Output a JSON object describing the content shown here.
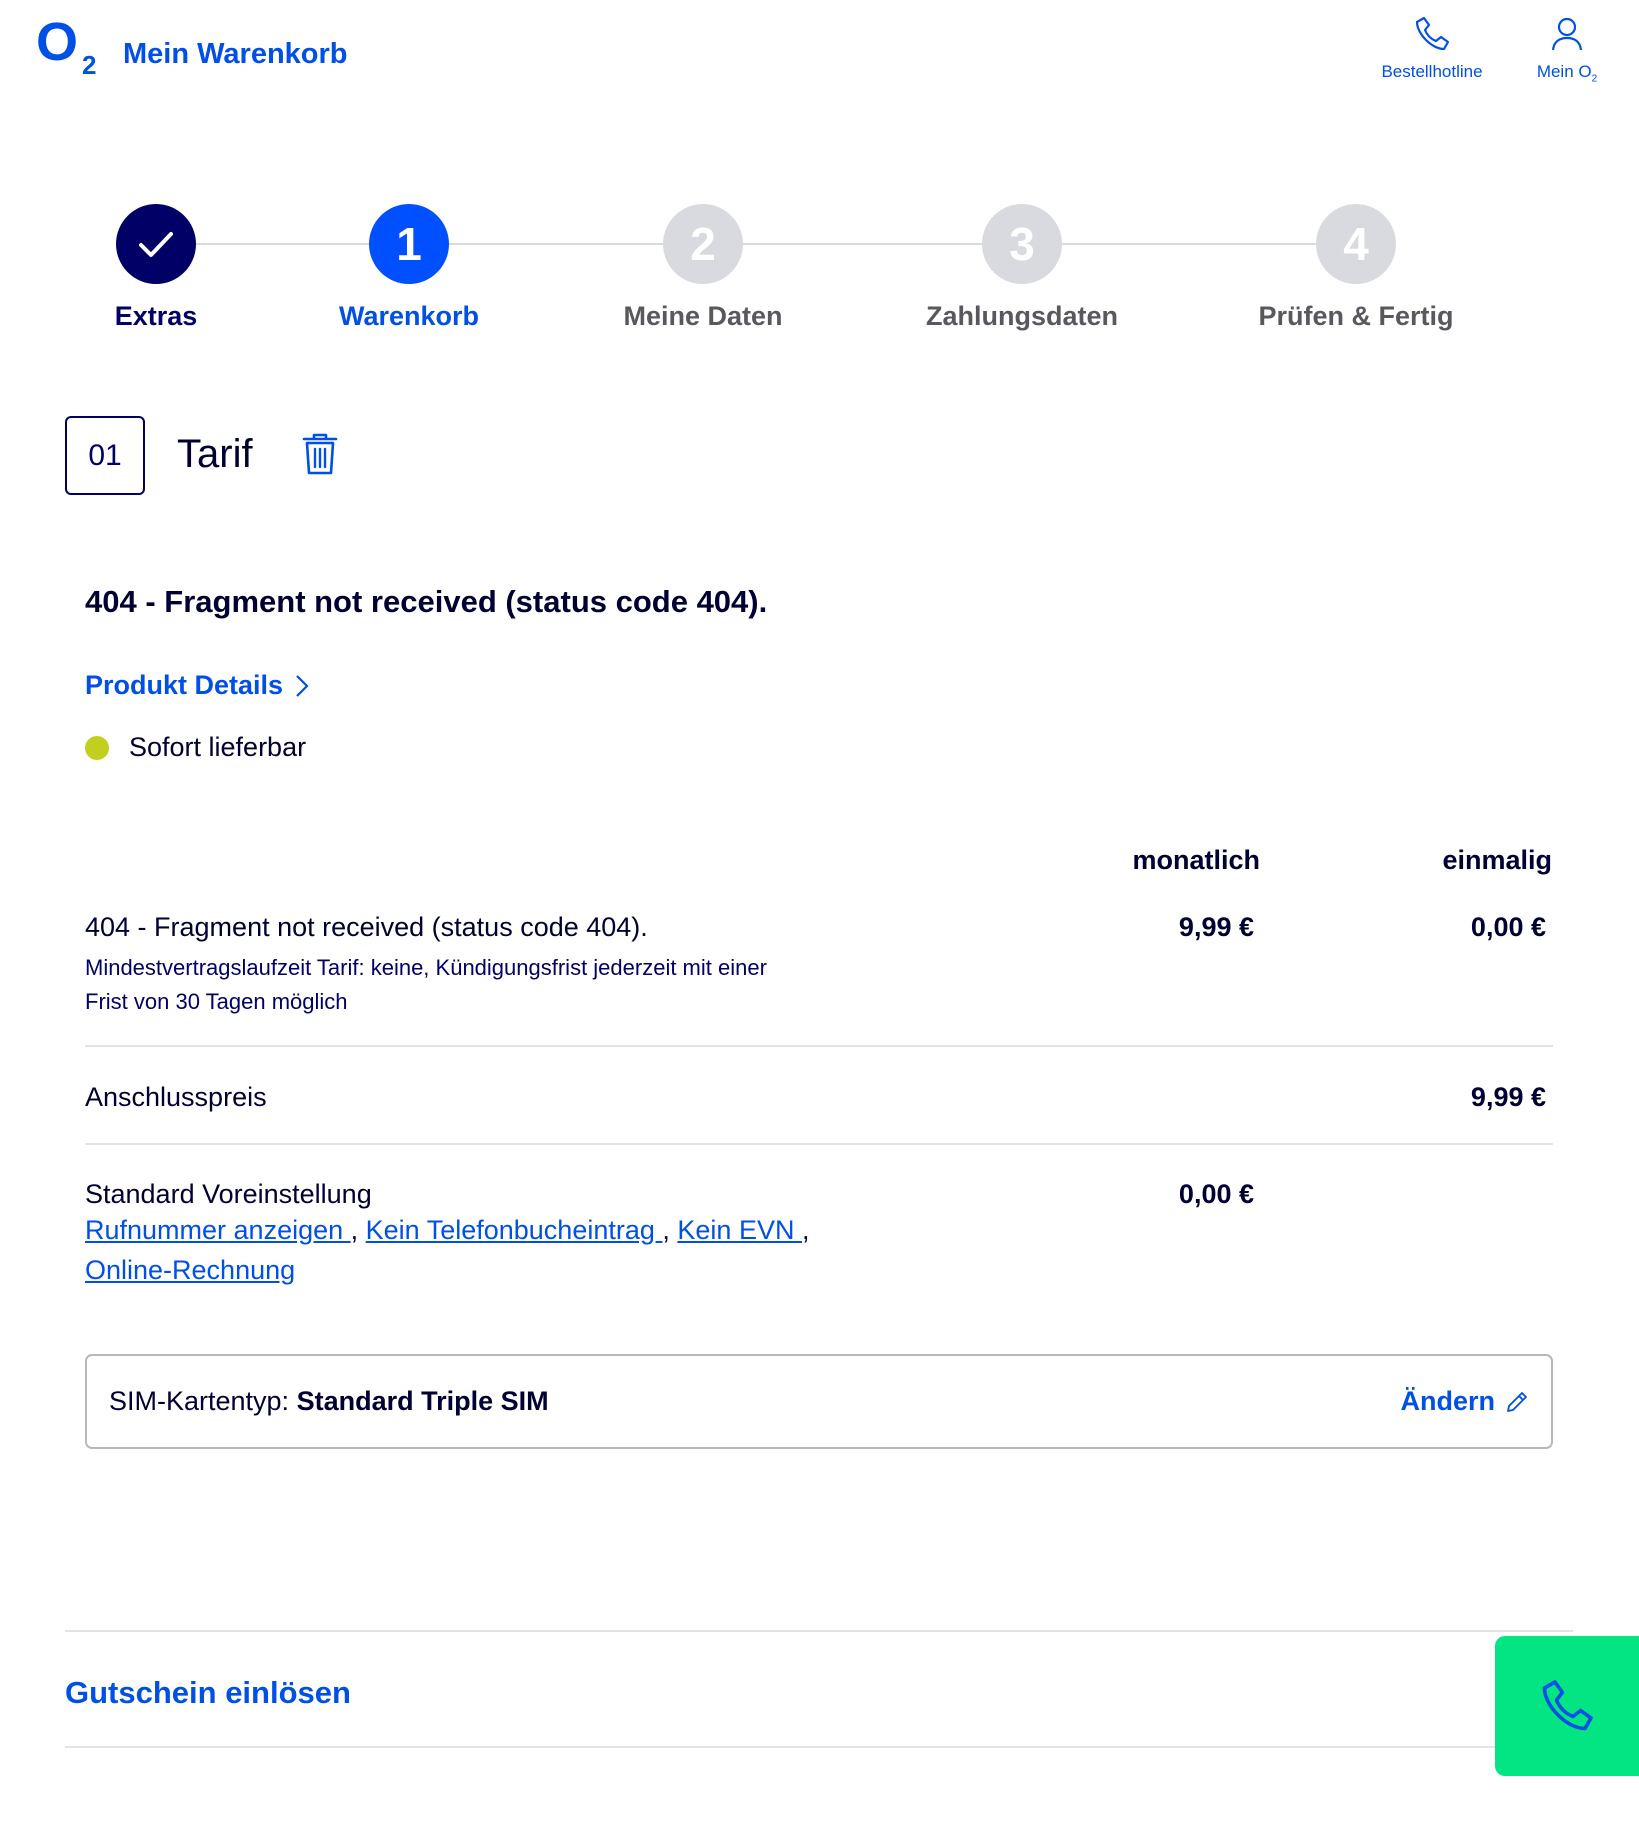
{
  "brand": {
    "logo_letter": "O",
    "logo_sub": "2",
    "accent": "#0050e6",
    "dark": "#000066",
    "success_green": "#03e583",
    "availability_dot": "#c1d01f"
  },
  "header": {
    "title": "Mein Warenkorb",
    "hotline_label": "Bestellhotline",
    "account_label": "Mein O",
    "account_sub": "2"
  },
  "stepper": {
    "steps": [
      {
        "marker": "",
        "label": "Extras",
        "state": "done"
      },
      {
        "marker": "1",
        "label": "Warenkorb",
        "state": "active"
      },
      {
        "marker": "2",
        "label": "Meine Daten",
        "state": "pending"
      },
      {
        "marker": "3",
        "label": "Zahlungsdaten",
        "state": "pending"
      },
      {
        "marker": "4",
        "label": "Prüfen & Fertig",
        "state": "pending"
      }
    ]
  },
  "section": {
    "index": "01",
    "title": "Tarif"
  },
  "product": {
    "title": "404 - Fragment not received (status code 404).",
    "details_link": "Produkt Details",
    "availability": "Sofort lieferbar"
  },
  "columns": {
    "monthly": "monatlich",
    "once": "einmalig"
  },
  "rows": {
    "tariff": {
      "name": "404 - Fragment not received (status code 404).",
      "note": "Mindestvertragslaufzeit Tarif: keine, Kündigungsfrist jederzeit mit einer Frist von 30 Tagen möglich",
      "monthly": "9,99 €",
      "once": "0,00 €"
    },
    "connection": {
      "name": "Anschlusspreis",
      "once": "9,99 €"
    },
    "defaults": {
      "name": "Standard Voreinstellung",
      "monthly": "0,00 €",
      "links": [
        "Rufnummer anzeigen ",
        "Kein Telefonbucheintrag ",
        "Kein EVN ",
        "Online-Rechnung"
      ]
    }
  },
  "sim": {
    "label": "SIM-Kartentyp:",
    "value": "Standard Triple SIM",
    "change": "Ändern"
  },
  "voucher": {
    "label": "Gutschein einlösen"
  }
}
